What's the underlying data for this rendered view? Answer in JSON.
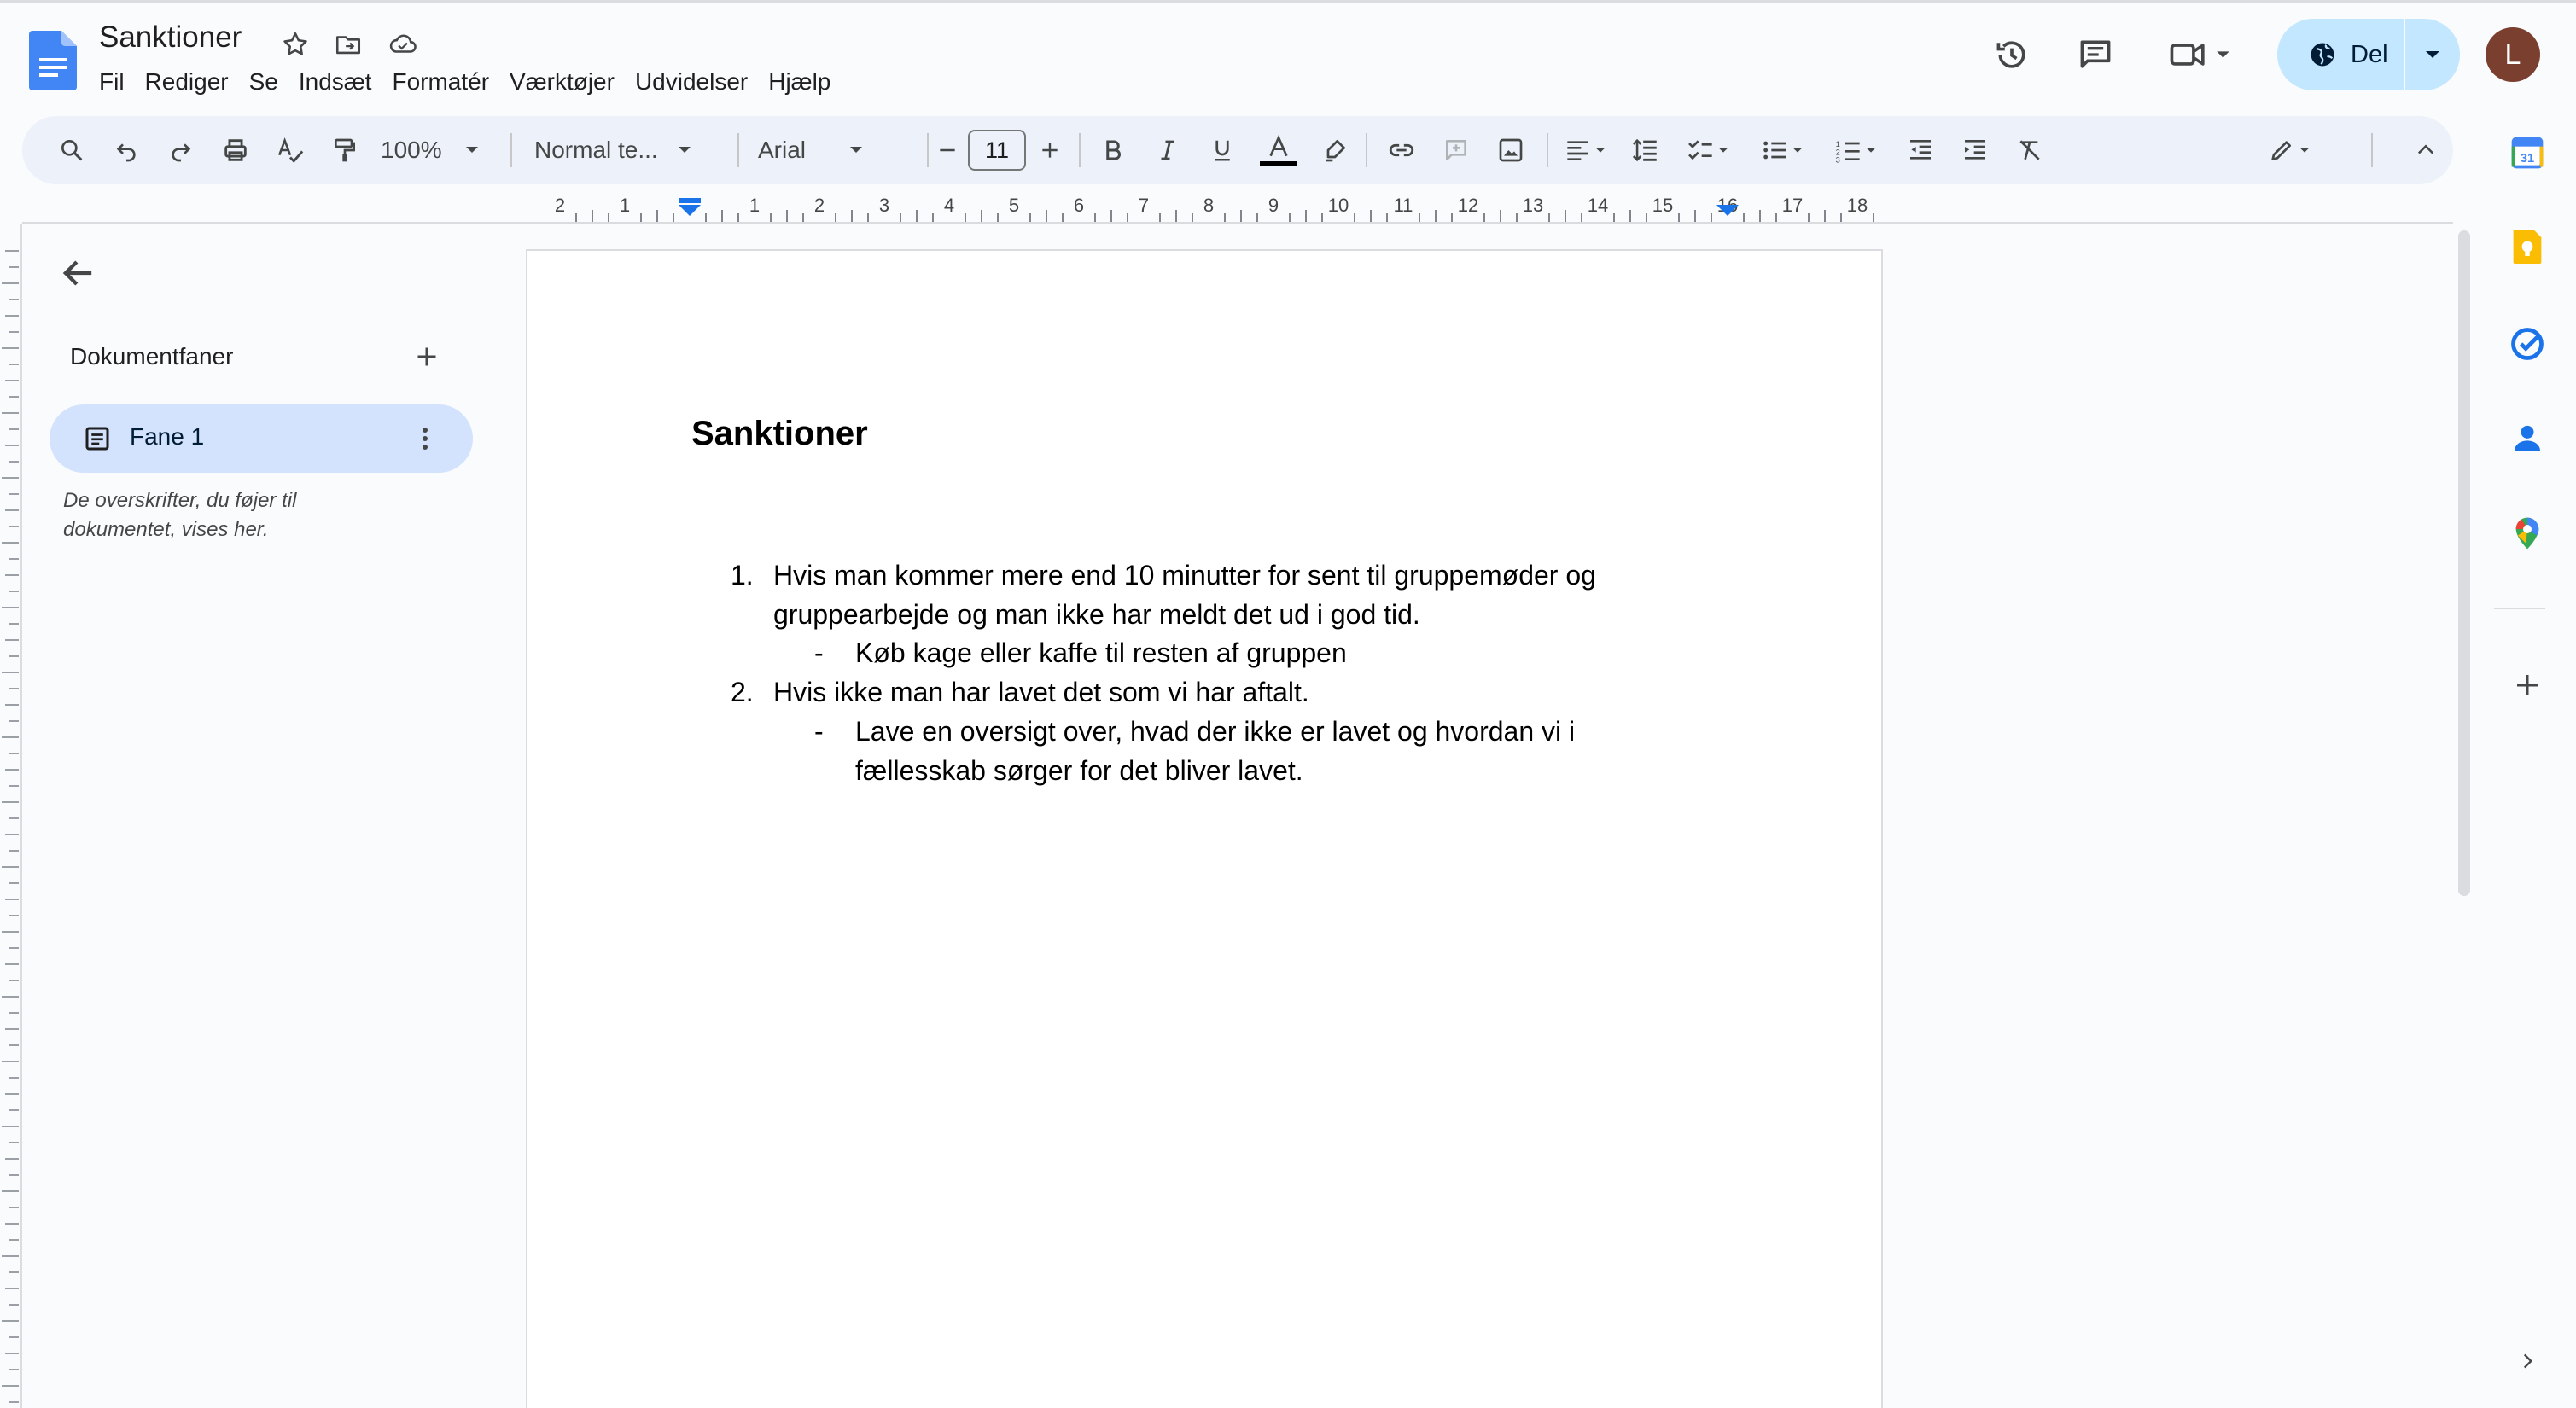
{
  "app": {
    "title": "Sanktioner",
    "menu": [
      "Fil",
      "Rediger",
      "Se",
      "Indsæt",
      "Formatér",
      "Værktøjer",
      "Udvidelser",
      "Hjælp"
    ],
    "share_label": "Del",
    "avatar_letter": "L"
  },
  "toolbar": {
    "zoom": "100%",
    "style": "Normal te...",
    "font": "Arial",
    "font_size": "11"
  },
  "ruler": {
    "labels": [
      "2",
      "1",
      "1",
      "2",
      "3",
      "4",
      "5",
      "6",
      "7",
      "8",
      "9",
      "10",
      "11",
      "12",
      "13",
      "14",
      "15",
      "16",
      "17",
      "18"
    ]
  },
  "outline": {
    "heading": "Dokumentfaner",
    "tab_label": "Fane 1",
    "hint": "De overskrifter, du føjer til dokumentet, vises her."
  },
  "document": {
    "heading": "Sanktioner",
    "items": [
      {
        "marker": "1.",
        "lines": [
          "Hvis man kommer mere end 10 minutter for sent til gruppemøder og",
          "gruppearbejde og man ikke har meldt det ud i god tid."
        ]
      },
      {
        "marker": "-",
        "lines": [
          "Køb kage eller kaffe til resten af gruppen"
        ]
      },
      {
        "marker": "2.",
        "lines": [
          "Hvis ikke man har lavet det som vi har aftalt."
        ]
      },
      {
        "marker": "-",
        "lines": [
          "Lave en oversigt over, hvad der ikke er lavet og hvordan vi i",
          "fællesskab sørger for det bliver lavet."
        ]
      }
    ]
  },
  "colors": {
    "accent": "#0b57d0",
    "share_bg": "#c2e7ff",
    "tab_bg": "#d3e3fd",
    "toolbar_bg": "#edf2fa",
    "avatar_bg": "#7b3f30"
  }
}
